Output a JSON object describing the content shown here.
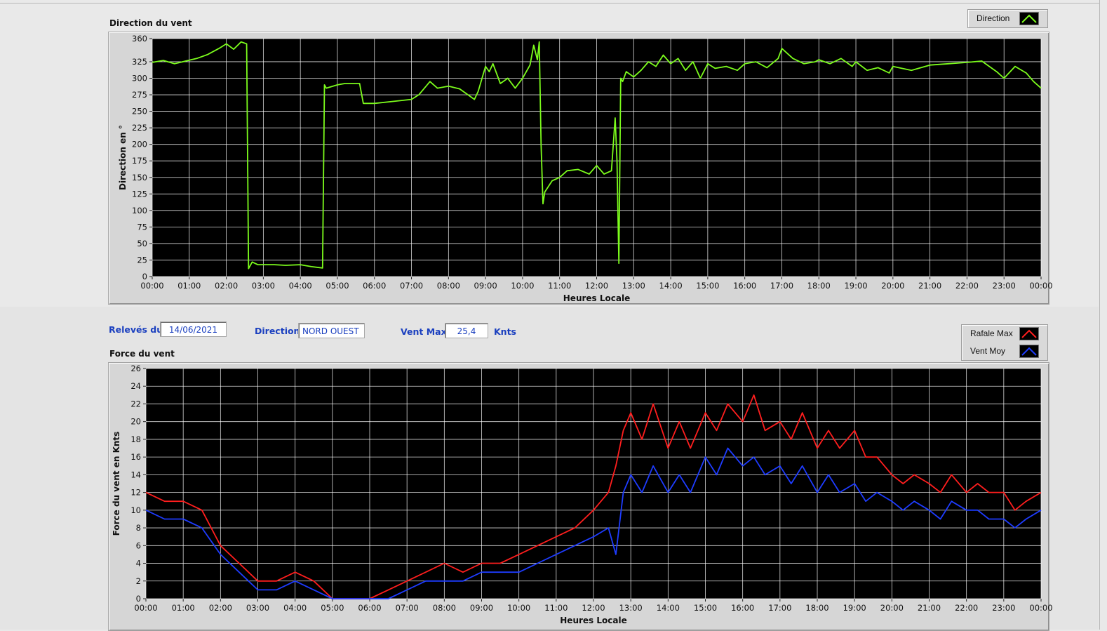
{
  "info": {
    "releves_label": "Relevés du",
    "date": "14/06/2021",
    "direction_label": "Direction",
    "direction_value": "NORD OUEST",
    "vent_max_label": "Vent Max",
    "vent_max_value": "25,4",
    "unit_label": "Knts"
  },
  "legend_direction": {
    "label": "Direction",
    "color": "#7CFC1C"
  },
  "legend_force": [
    {
      "label": "Rafale Max",
      "color": "#ff1e1e"
    },
    {
      "label": "Vent Moy",
      "color": "#1e3cff"
    }
  ],
  "chart_data": [
    {
      "type": "line",
      "title": "Direction du vent",
      "xlabel": "Heures Locale",
      "ylabel": "Direction en °",
      "x_ticks": [
        "00:00",
        "01:00",
        "02:00",
        "03:00",
        "04:00",
        "05:00",
        "06:00",
        "07:00",
        "08:00",
        "09:00",
        "10:00",
        "11:00",
        "12:00",
        "13:00",
        "14:00",
        "15:00",
        "16:00",
        "17:00",
        "18:00",
        "19:00",
        "20:00",
        "21:00",
        "22:00",
        "23:00",
        "00:00"
      ],
      "y_ticks": [
        0,
        25,
        50,
        75,
        100,
        125,
        150,
        175,
        200,
        225,
        250,
        275,
        300,
        325,
        360
      ],
      "xlim": [
        0,
        24
      ],
      "ylim": [
        0,
        360
      ],
      "grid": true,
      "legend_position": "top-right",
      "background": "#000000",
      "series": [
        {
          "name": "Direction",
          "color": "#7CFC1C",
          "x": [
            0,
            0.3,
            0.6,
            0.9,
            1.2,
            1.5,
            1.8,
            2.0,
            2.2,
            2.4,
            2.55,
            2.6,
            2.7,
            2.85,
            3.0,
            3.3,
            3.6,
            4.0,
            4.3,
            4.6,
            4.65,
            4.7,
            5.0,
            5.2,
            5.6,
            5.7,
            6.0,
            6.5,
            7.0,
            7.2,
            7.5,
            7.7,
            8.0,
            8.3,
            8.7,
            8.8,
            9.0,
            9.1,
            9.2,
            9.4,
            9.6,
            9.8,
            10.0,
            10.2,
            10.3,
            10.4,
            10.45,
            10.5,
            10.55,
            10.6,
            10.8,
            11.0,
            11.2,
            11.5,
            11.8,
            12.0,
            12.2,
            12.4,
            12.5,
            12.55,
            12.6,
            12.65,
            12.7,
            12.8,
            13.0,
            13.2,
            13.4,
            13.6,
            13.8,
            14.0,
            14.2,
            14.4,
            14.6,
            14.8,
            15.0,
            15.2,
            15.5,
            15.8,
            16.0,
            16.3,
            16.6,
            16.9,
            17.0,
            17.3,
            17.6,
            17.9,
            18.0,
            18.3,
            18.6,
            18.9,
            19.0,
            19.3,
            19.6,
            19.9,
            20.0,
            20.5,
            21.0,
            21.5,
            22.0,
            22.4,
            22.8,
            23.0,
            23.3,
            23.6,
            23.8,
            24.0
          ],
          "y": [
            324,
            327,
            322,
            326,
            330,
            336,
            345,
            352,
            344,
            355,
            352,
            12,
            22,
            18,
            18,
            18,
            17,
            18,
            15,
            13,
            290,
            285,
            290,
            292,
            292,
            262,
            262,
            265,
            268,
            275,
            295,
            285,
            288,
            284,
            268,
            280,
            318,
            310,
            322,
            292,
            300,
            285,
            300,
            320,
            350,
            328,
            355,
            200,
            110,
            128,
            145,
            150,
            160,
            162,
            155,
            168,
            155,
            160,
            240,
            175,
            20,
            300,
            295,
            310,
            302,
            312,
            325,
            318,
            335,
            322,
            330,
            312,
            325,
            300,
            322,
            315,
            318,
            312,
            322,
            325,
            316,
            330,
            345,
            330,
            322,
            325,
            328,
            322,
            330,
            318,
            325,
            312,
            316,
            308,
            318,
            312,
            320,
            322,
            324,
            326,
            310,
            300,
            318,
            308,
            295,
            285
          ]
        }
      ]
    },
    {
      "type": "line",
      "title": "Force du vent",
      "xlabel": "Heures Locale",
      "ylabel": "Force du vent en Knts",
      "x_ticks": [
        "00:00",
        "01:00",
        "02:00",
        "03:00",
        "04:00",
        "05:00",
        "06:00",
        "07:00",
        "08:00",
        "09:00",
        "10:00",
        "11:00",
        "12:00",
        "13:00",
        "14:00",
        "15:00",
        "16:00",
        "17:00",
        "18:00",
        "19:00",
        "20:00",
        "21:00",
        "22:00",
        "23:00",
        "00:00"
      ],
      "y_ticks": [
        0,
        2,
        4,
        6,
        8,
        10,
        12,
        14,
        16,
        18,
        20,
        22,
        24,
        26
      ],
      "xlim": [
        0,
        24
      ],
      "ylim": [
        0,
        26
      ],
      "grid": true,
      "legend_position": "top-right",
      "background": "#000000",
      "series": [
        {
          "name": "Rafale Max",
          "color": "#ff1e1e",
          "x": [
            0,
            0.5,
            1.0,
            1.5,
            2.0,
            2.5,
            3.0,
            3.5,
            4.0,
            4.5,
            5.0,
            5.5,
            6.0,
            6.5,
            7.0,
            7.5,
            8.0,
            8.5,
            9.0,
            9.5,
            10.0,
            10.5,
            11.0,
            11.5,
            12.0,
            12.4,
            12.6,
            12.8,
            13.0,
            13.3,
            13.6,
            14.0,
            14.3,
            14.6,
            15.0,
            15.3,
            15.6,
            16.0,
            16.3,
            16.6,
            17.0,
            17.3,
            17.6,
            18.0,
            18.3,
            18.6,
            19.0,
            19.3,
            19.6,
            20.0,
            20.3,
            20.6,
            21.0,
            21.3,
            21.6,
            22.0,
            22.3,
            22.6,
            23.0,
            23.3,
            23.6,
            24.0
          ],
          "y": [
            12,
            11,
            11,
            10,
            6,
            4,
            2,
            2,
            3,
            2,
            0,
            0,
            0,
            1,
            2,
            3,
            4,
            3,
            4,
            4,
            5,
            6,
            7,
            8,
            10,
            12,
            15,
            19,
            21,
            18,
            22,
            17,
            20,
            17,
            21,
            19,
            22,
            20,
            23,
            19,
            20,
            18,
            21,
            17,
            19,
            17,
            19,
            16,
            16,
            14,
            13,
            14,
            13,
            12,
            14,
            12,
            13,
            12,
            12,
            10,
            11,
            12
          ]
        },
        {
          "name": "Vent Moy",
          "color": "#1e3cff",
          "x": [
            0,
            0.5,
            1.0,
            1.5,
            2.0,
            2.5,
            3.0,
            3.5,
            4.0,
            4.5,
            5.0,
            5.5,
            6.0,
            6.5,
            7.0,
            7.5,
            8.0,
            8.5,
            9.0,
            9.5,
            10.0,
            10.5,
            11.0,
            11.5,
            12.0,
            12.4,
            12.6,
            12.8,
            13.0,
            13.3,
            13.6,
            14.0,
            14.3,
            14.6,
            15.0,
            15.3,
            15.6,
            16.0,
            16.3,
            16.6,
            17.0,
            17.3,
            17.6,
            18.0,
            18.3,
            18.6,
            19.0,
            19.3,
            19.6,
            20.0,
            20.3,
            20.6,
            21.0,
            21.3,
            21.6,
            22.0,
            22.3,
            22.6,
            23.0,
            23.3,
            23.6,
            24.0
          ],
          "y": [
            10,
            9,
            9,
            8,
            5,
            3,
            1,
            1,
            2,
            1,
            0,
            0,
            0,
            0,
            1,
            2,
            2,
            2,
            3,
            3,
            3,
            4,
            5,
            6,
            7,
            8,
            5,
            12,
            14,
            12,
            15,
            12,
            14,
            12,
            16,
            14,
            17,
            15,
            16,
            14,
            15,
            13,
            15,
            12,
            14,
            12,
            13,
            11,
            12,
            11,
            10,
            11,
            10,
            9,
            11,
            10,
            10,
            9,
            9,
            8,
            9,
            10
          ]
        }
      ]
    }
  ]
}
